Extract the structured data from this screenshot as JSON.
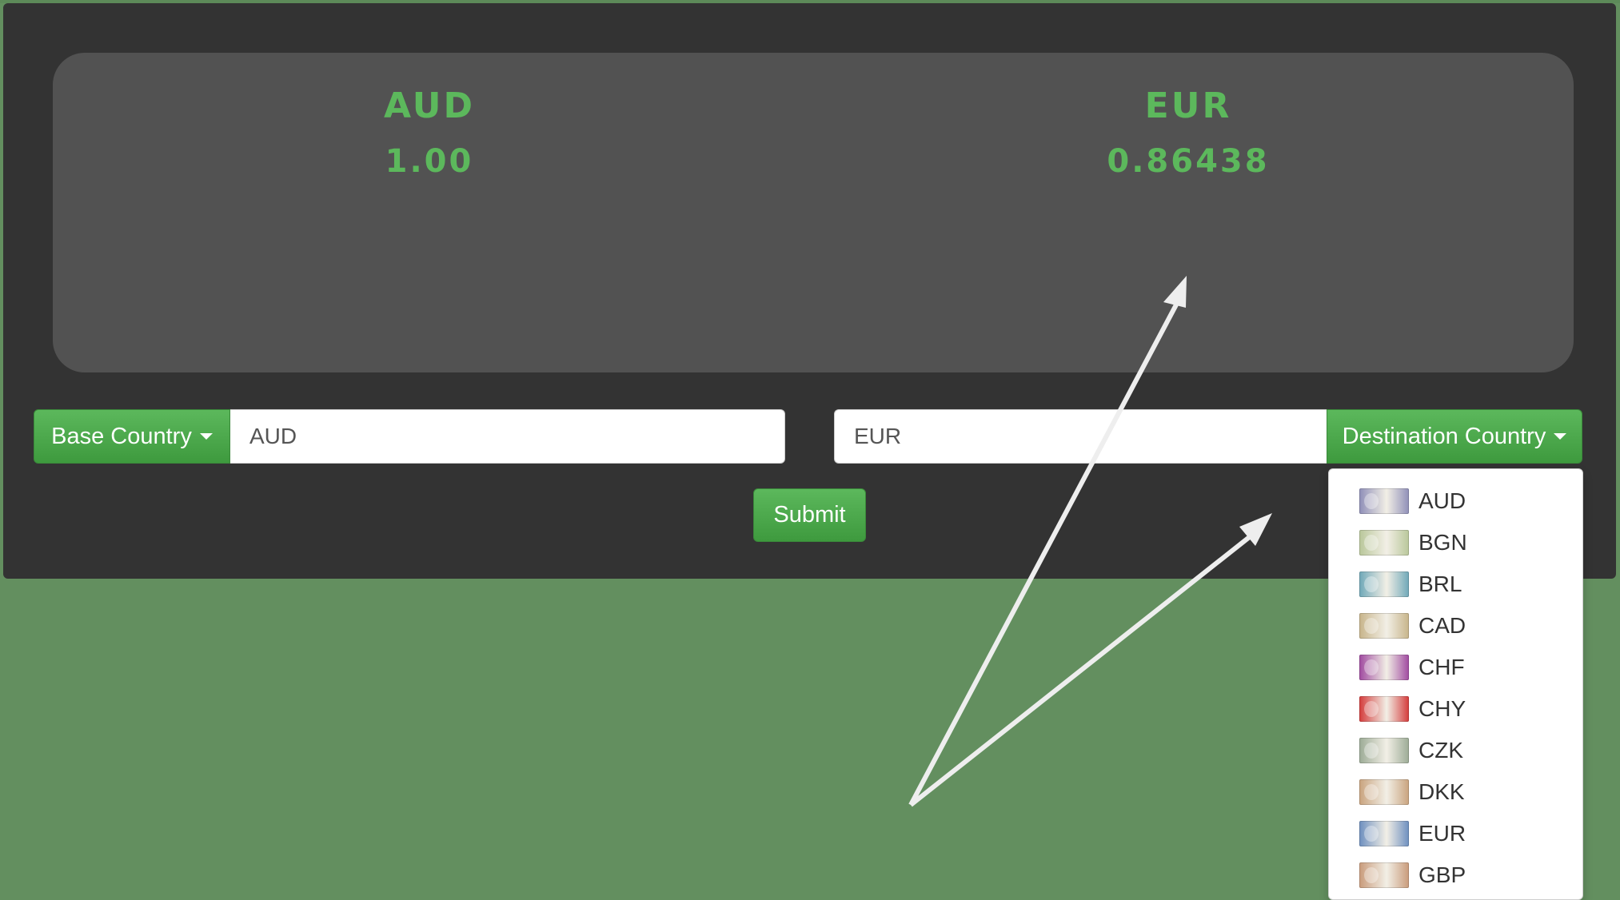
{
  "display": {
    "base": {
      "code": "AUD",
      "value": "1.00"
    },
    "destination": {
      "code": "EUR",
      "value": "0.86438"
    }
  },
  "controls": {
    "base_button_label": "Base Country",
    "base_input_value": "AUD",
    "destination_input_value": "EUR",
    "destination_button_label": "Destination Country",
    "submit_label": "Submit"
  },
  "dropdown": {
    "items": [
      {
        "label": "AUD",
        "note_color": "#8f8fb8"
      },
      {
        "label": "BGN",
        "note_color": "#b9c79a"
      },
      {
        "label": "BRL",
        "note_color": "#6fa8b8"
      },
      {
        "label": "CAD",
        "note_color": "#c7b48a"
      },
      {
        "label": "CHF",
        "note_color": "#a04aa0"
      },
      {
        "label": "CHY",
        "note_color": "#d43b3b"
      },
      {
        "label": "CZK",
        "note_color": "#9cab96"
      },
      {
        "label": "DKK",
        "note_color": "#c9a37e"
      },
      {
        "label": "EUR",
        "note_color": "#6d8fbf"
      },
      {
        "label": "GBP",
        "note_color": "#c99b7b"
      }
    ]
  },
  "colors": {
    "page_background": "#638f5f",
    "panel_background": "#333333",
    "display_background": "#525252",
    "accent_green": "#5cb85c",
    "arrow_color": "#eeeeee"
  }
}
